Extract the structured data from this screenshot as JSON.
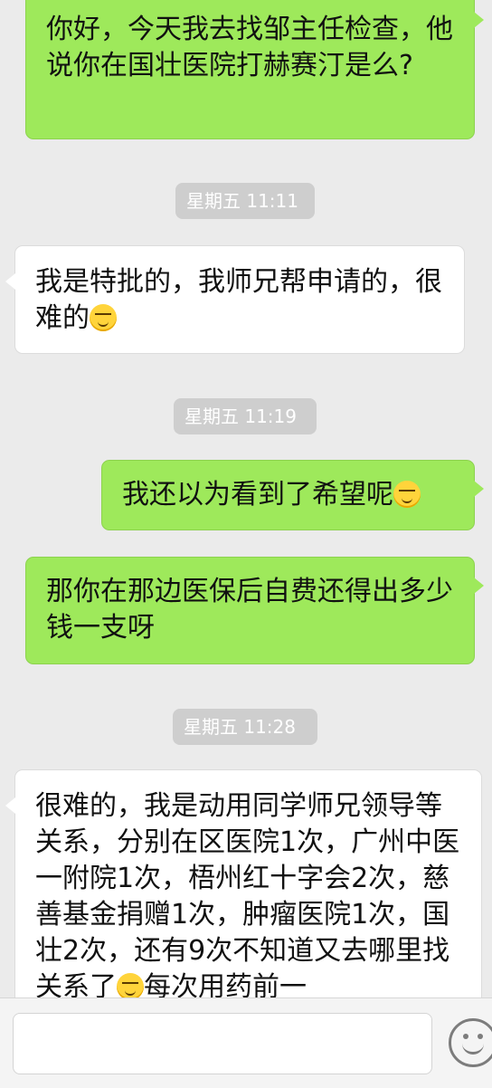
{
  "messages": [
    {
      "side": "sent",
      "text": "你好，今天我去找邹主任检查，他说你在国壮医院打赫赛汀是么?"
    },
    {
      "timestamp": "星期五 11:11"
    },
    {
      "side": "received",
      "text": "我是特批的，我师兄帮申请的，很难的",
      "emoji": "grimacing-squint-emoji"
    },
    {
      "timestamp": "星期五 11:19"
    },
    {
      "side": "sent",
      "text": "我还以为看到了希望呢",
      "emoji": "pensive-face-emoji"
    },
    {
      "side": "sent",
      "text": "那你在那边医保后自费还得出多少钱一支呀"
    },
    {
      "timestamp": "星期五 11:28"
    },
    {
      "side": "received",
      "text_before_emoji": "很难的，我是动用同学师兄领导等关系，分别在区医院1次，广州中医一附院1次，梧州红十字会2次，慈善基金捐赠1次，肿瘤医院1次，国壮2次，还有9次不知道又去哪里找关系了",
      "emoji": "grimacing-squint-emoji",
      "text_after_emoji": "每次用药前一"
    }
  ],
  "input_bar": {
    "input_value": "",
    "emoji_button_icon": "smiley-face-icon"
  },
  "colors": {
    "background": "#ebebeb",
    "sent_bubble": "#9ee95b",
    "received_bubble": "#ffffff",
    "timestamp_pill": "#cecece"
  }
}
